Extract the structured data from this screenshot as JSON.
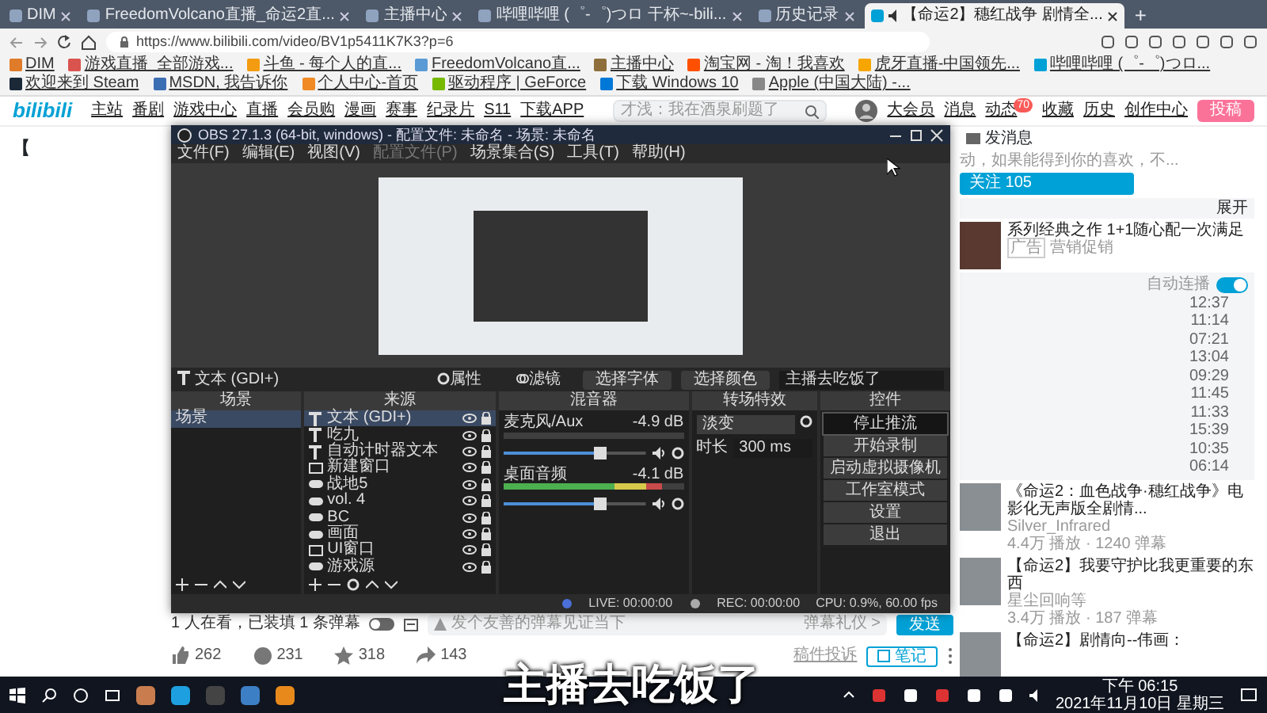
{
  "browser": {
    "tabs": [
      {
        "title": "DIM",
        "selected": false
      },
      {
        "title": "FreedomVolcano直播_命运2直...",
        "selected": false
      },
      {
        "title": "主播中心",
        "selected": false
      },
      {
        "title": "哔哩哔哩 (゜-゜)つロ 干杯~-bili...",
        "selected": false
      },
      {
        "title": "历史记录",
        "selected": false
      },
      {
        "title": "【命运2】穗红战争 剧情全...",
        "selected": true
      }
    ],
    "new_tab": "+",
    "url": "https://www.bilibili.com/video/BV1p5411K7K3?p=6",
    "bookmarks": [
      "DIM",
      "游戏直播_全部游戏...",
      "斗鱼 - 每个人的直...",
      "FreedomVolcano直...",
      "主播中心",
      "淘宝网 - 淘！我喜欢",
      "虎牙直播-中国领先...",
      "哔哩哔哩 (゜-゜)つロ...",
      "欢迎来到 Steam",
      "MSDN, 我告诉你",
      "个人中心-首页",
      "驱动程序 | GeForce",
      "下载 Windows 10",
      "Apple (中国大陆) -..."
    ]
  },
  "site_nav": {
    "logo": "bilibili",
    "links": [
      "主站",
      "番剧",
      "游戏中心",
      "直播",
      "会员购",
      "漫画",
      "赛事",
      "纪录片",
      "S11",
      "下载APP"
    ],
    "search_placeholder": "才浅：我在酒泉刷题了",
    "user_links": [
      {
        "label": "大会员"
      },
      {
        "label": "消息"
      },
      {
        "label": "动态",
        "badge": "70"
      },
      {
        "label": "收藏"
      },
      {
        "label": "历史"
      },
      {
        "label": "创作中心"
      }
    ],
    "upload_button": "投稿"
  },
  "page_fragment": "【",
  "obs": {
    "title": "OBS 27.1.3 (64-bit, windows) - 配置文件: 未命名 - 场景: 未命名",
    "menu": [
      {
        "label": "文件(F)",
        "disabled": false
      },
      {
        "label": "编辑(E)",
        "disabled": false
      },
      {
        "label": "视图(V)",
        "disabled": false
      },
      {
        "label": "配置文件(P)",
        "disabled": true
      },
      {
        "label": "场景集合(S)",
        "disabled": false
      },
      {
        "label": "工具(T)",
        "disabled": false
      },
      {
        "label": "帮助(H)",
        "disabled": false
      }
    ],
    "source_toolbar": {
      "source": "文本 (GDI+)",
      "properties": "属性",
      "filters": "滤镜",
      "font_button": "选择字体",
      "color_button": "选择颜色",
      "text_value": "主播去吃饭了"
    },
    "docks": {
      "scenes": "场景",
      "sources": "来源",
      "mixer": "混音器",
      "transitions": "转场特效",
      "controls": "控件"
    },
    "scenes": [
      {
        "name": "场景",
        "selected": true
      }
    ],
    "sources": [
      {
        "name": "文本 (GDI+)",
        "kind": "text",
        "selected": true
      },
      {
        "name": "吃九",
        "kind": "text",
        "selected": false
      },
      {
        "name": "自动计时器文本",
        "kind": "text",
        "selected": false
      },
      {
        "name": "新建窗口",
        "kind": "window",
        "selected": false
      },
      {
        "name": "战地5",
        "kind": "game",
        "selected": false
      },
      {
        "name": "vol. 4",
        "kind": "game",
        "selected": false
      },
      {
        "name": "BC",
        "kind": "game",
        "selected": false
      },
      {
        "name": "画面",
        "kind": "game",
        "selected": false
      },
      {
        "name": "UI窗口",
        "kind": "window",
        "selected": false
      },
      {
        "name": "游戏源",
        "kind": "game",
        "selected": false
      }
    ],
    "mixer": [
      {
        "name": "麦克风/Aux",
        "reading": "-4.9 dB",
        "meter": {
          "level": 0.0
        },
        "volume": {
          "level": 0.72
        }
      },
      {
        "name": "桌面音频",
        "reading": "-4.1 dB",
        "meter": {
          "level": 0.88
        },
        "volume": {
          "level": 0.72
        }
      }
    ],
    "transition": {
      "type": "淡变",
      "duration_label": "时长",
      "duration": "300 ms"
    },
    "controls": [
      {
        "label": "停止推流",
        "active": true
      },
      {
        "label": "开始录制",
        "active": false
      },
      {
        "label": "启动虚拟摄像机",
        "active": false
      },
      {
        "label": "工作室模式",
        "active": false
      },
      {
        "label": "设置",
        "active": false
      },
      {
        "label": "退出",
        "active": false
      }
    ],
    "status": {
      "live": "LIVE: 00:00:00",
      "rec": "REC: 00:00:00",
      "cpu": "CPU: 0.9%, 60.00 fps"
    }
  },
  "uploader": {
    "message": "发消息",
    "description": "动，如果能得到你的喜欢，不...",
    "follow_button": "关注 105"
  },
  "sidebar": {
    "expand": "展开",
    "ad": {
      "title": "系列经典之作 1+1随心配一次满足",
      "tag": "广告",
      "advertiser": "营销促销"
    },
    "playlist": {
      "autoplay_label": "自动连播",
      "autoplay": {
        "on": true
      },
      "durations": [
        "12:37",
        "11:14",
        "07:21",
        "13:04",
        "09:29",
        "11:45",
        "11:33",
        "15:39",
        "10:35",
        "06:14"
      ]
    },
    "recommended": [
      {
        "title": "《命运2：血色战争·穗红战争》电影化无声版全剧情...",
        "author": "Silver_Infrared",
        "stats": "4.4万 播放 · 1240 弹幕"
      },
      {
        "title": "【命运2】我要守护比我更重要的东西",
        "author": "星尘回响等",
        "stats": "3.4万 播放 · 187 弹幕"
      },
      {
        "title": "【命运2】剧情向--伟画："
      }
    ]
  },
  "danmaku_bar": {
    "viewers": "1 人在看，已装填 1 条弹幕",
    "placeholder": "发个友善的弹幕见证当下",
    "etiquette": "弹幕礼仪 >",
    "send_button": "发送"
  },
  "actions": [
    {
      "kind": "like",
      "count": "262"
    },
    {
      "kind": "coin",
      "count": "231"
    },
    {
      "kind": "favorite",
      "count": "318"
    },
    {
      "kind": "share",
      "count": "143"
    }
  ],
  "report": "稿件投诉",
  "note_button": "笔记",
  "subtitle": "主播去吃饭了",
  "taskbar": {
    "time": "下午 06:15",
    "date": "2021年11月10日 星期三"
  }
}
